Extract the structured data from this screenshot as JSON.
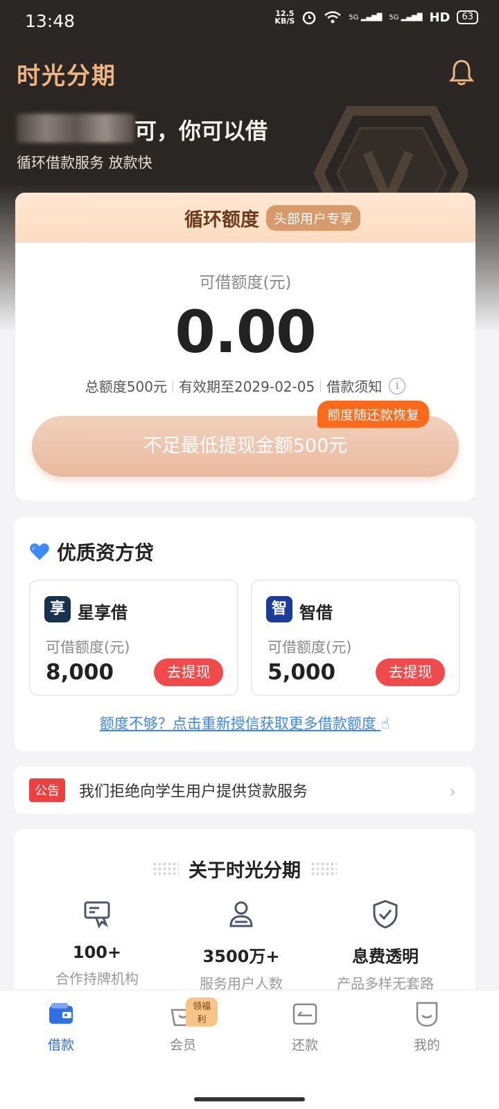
{
  "status_bar": {
    "time": "13:48",
    "net_speed_value": "12.5",
    "net_speed_unit": "KB/S",
    "signal_1": "5G",
    "signal_2": "5G",
    "hd_label": "HD",
    "battery": "63"
  },
  "header": {
    "app_title": "时光分期",
    "greeting_suffix": "可，你可以借",
    "subtitle": "循环借款服务 放款快"
  },
  "credit_card": {
    "title": "循环额度",
    "tag": "头部用户专享",
    "available_label": "可借额度(元)",
    "available_amount": "0.00",
    "total_quota": "总额度500元",
    "valid_until": "有效期至2029-02-05",
    "loan_notice": "借款须知",
    "withdraw_button": "不足最低提现金额500元",
    "restore_tip": "额度随还款恢复"
  },
  "products": {
    "title": "优质资方贷",
    "items": [
      {
        "logo_text": "享",
        "name": "星享借",
        "label": "可借额度(元)",
        "amount": "8,000",
        "button": "去提现",
        "logo_color": "#17324f"
      },
      {
        "logo_text": "智",
        "name": "智借",
        "label": "可借额度(元)",
        "amount": "5,000",
        "button": "去提现",
        "logo_color": "#1a3d9c"
      }
    ],
    "reauth_link": "额度不够？点击重新授信获取更多借款额度"
  },
  "notice": {
    "tag": "公告",
    "text": "我们拒绝向学生用户提供贷款服务"
  },
  "about": {
    "title": "关于时光分期",
    "stats": [
      {
        "icon": "license-icon",
        "value": "100+",
        "label": "合作持牌机构"
      },
      {
        "icon": "users-icon",
        "value": "3500万+",
        "label": "服务用户人数"
      },
      {
        "icon": "shield-check-icon",
        "value": "息费透明",
        "label": "产品多样无套路"
      }
    ]
  },
  "bottom_nav": {
    "items": [
      {
        "label": "借款",
        "icon": "wallet-icon",
        "active": true
      },
      {
        "label": "会员",
        "icon": "basket-icon",
        "active": false,
        "badge": "领福利"
      },
      {
        "label": "还款",
        "icon": "repay-icon",
        "active": false
      },
      {
        "label": "我的",
        "icon": "profile-icon",
        "active": false
      }
    ]
  },
  "colors": {
    "brand_gold": "#f0b47c",
    "accent_blue": "#2f6fe8",
    "accent_red": "#f24a4a",
    "accent_orange": "#ff6a1a"
  }
}
